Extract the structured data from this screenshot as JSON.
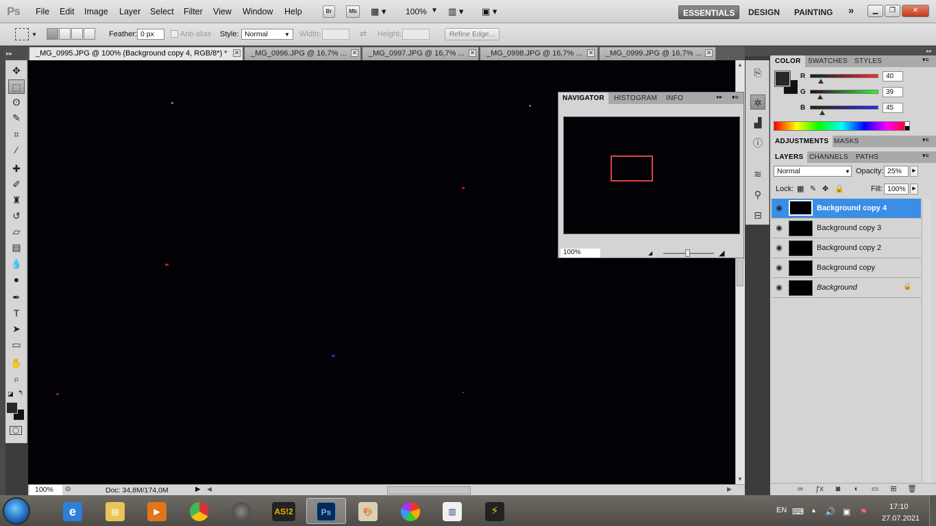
{
  "app": {
    "logo": "Ps",
    "menu": [
      "File",
      "Edit",
      "Image",
      "Layer",
      "Select",
      "Filter",
      "View",
      "Window",
      "Help"
    ],
    "bridge_label": "Br",
    "minibridge_label": "Mb",
    "zoom": "100%",
    "workspaces": [
      "ESSENTIALS",
      "DESIGN",
      "PAINTING"
    ],
    "more_workspaces": "»"
  },
  "options": {
    "feather_label": "Feather:",
    "feather_value": "0 px",
    "antialias_label": "Anti-alias",
    "style_label": "Style:",
    "style_value": "Normal",
    "width_label": "Width:",
    "height_label": "Height:",
    "refine_label": "Refine Edge..."
  },
  "tabs": [
    "_MG_0995.JPG @ 100% (Background copy 4, RGB/8*) *",
    "_MG_0996.JPG @ 16,7% ...",
    "_MG_0997.JPG @ 16,7% ...",
    "_MG_0998.JPG @ 16,7% ...",
    "_MG_0999.JPG @ 16,7% ..."
  ],
  "tools": [
    {
      "icon": "move-tool-icon",
      "glyph": "✥"
    },
    {
      "icon": "marquee-tool-icon",
      "glyph": "⬚"
    },
    {
      "icon": "lasso-tool-icon",
      "glyph": "ʘ"
    },
    {
      "icon": "quick-selection-tool-icon",
      "glyph": "✎"
    },
    {
      "icon": "crop-tool-icon",
      "glyph": "⌗"
    },
    {
      "icon": "eyedropper-tool-icon",
      "glyph": "⁄"
    },
    {
      "icon": "healing-brush-tool-icon",
      "glyph": "✚"
    },
    {
      "icon": "brush-tool-icon",
      "glyph": "✐"
    },
    {
      "icon": "clone-stamp-tool-icon",
      "glyph": "♜"
    },
    {
      "icon": "history-brush-tool-icon",
      "glyph": "↺"
    },
    {
      "icon": "eraser-tool-icon",
      "glyph": "▱"
    },
    {
      "icon": "gradient-tool-icon",
      "glyph": "▤"
    },
    {
      "icon": "blur-tool-icon",
      "glyph": "💧"
    },
    {
      "icon": "dodge-tool-icon",
      "glyph": "●"
    },
    {
      "icon": "pen-tool-icon",
      "glyph": "✒"
    },
    {
      "icon": "type-tool-icon",
      "glyph": "T"
    },
    {
      "icon": "path-selection-tool-icon",
      "glyph": "➤"
    },
    {
      "icon": "shape-tool-icon",
      "glyph": "▭"
    },
    {
      "icon": "hand-tool-icon",
      "glyph": "✋"
    },
    {
      "icon": "zoom-tool-icon",
      "glyph": "⌕"
    }
  ],
  "status": {
    "zoom": "100%",
    "doc": "Doc: 34,8M/174,0M"
  },
  "navigator": {
    "tabs": [
      "NAVIGATOR",
      "HISTOGRAM",
      "INFO"
    ],
    "zoom": "100%"
  },
  "color_panel": {
    "tabs": [
      "COLOR",
      "SWATCHES",
      "STYLES"
    ],
    "r_label": "R",
    "g_label": "G",
    "b_label": "B",
    "r": "40",
    "g": "39",
    "b": "45",
    "r_level": 0.157,
    "g_level": 0.153,
    "b_level": 0.176,
    "fg_color": "#28272d"
  },
  "adjustments": {
    "tabs": [
      "ADJUSTMENTS",
      "MASKS"
    ]
  },
  "layers": {
    "tabs": [
      "LAYERS",
      "CHANNELS",
      "PATHS"
    ],
    "blend_mode": "Normal",
    "opacity_label": "Opacity:",
    "opacity": "25%",
    "lock_label": "Lock:",
    "fill_label": "Fill:",
    "fill": "100%",
    "items": [
      {
        "name": "Background copy 4",
        "selected": true
      },
      {
        "name": "Background copy 3",
        "selected": false
      },
      {
        "name": "Background copy 2",
        "selected": false
      },
      {
        "name": "Background copy",
        "selected": false
      },
      {
        "name": "Background",
        "selected": false,
        "locked": true
      }
    ]
  },
  "taskbar": {
    "apps": [
      "internet-explorer-icon",
      "file-explorer-icon",
      "media-player-icon",
      "chrome-icon",
      "globe-icon",
      "as12-icon",
      "photoshop-icon",
      "paint-icon",
      "photos-icon",
      "document-icon",
      "app-icon"
    ],
    "as12_label": "AS!2",
    "ps_label": "Ps",
    "lang": "EN",
    "time": "17:10",
    "date": "27.07.2021"
  }
}
